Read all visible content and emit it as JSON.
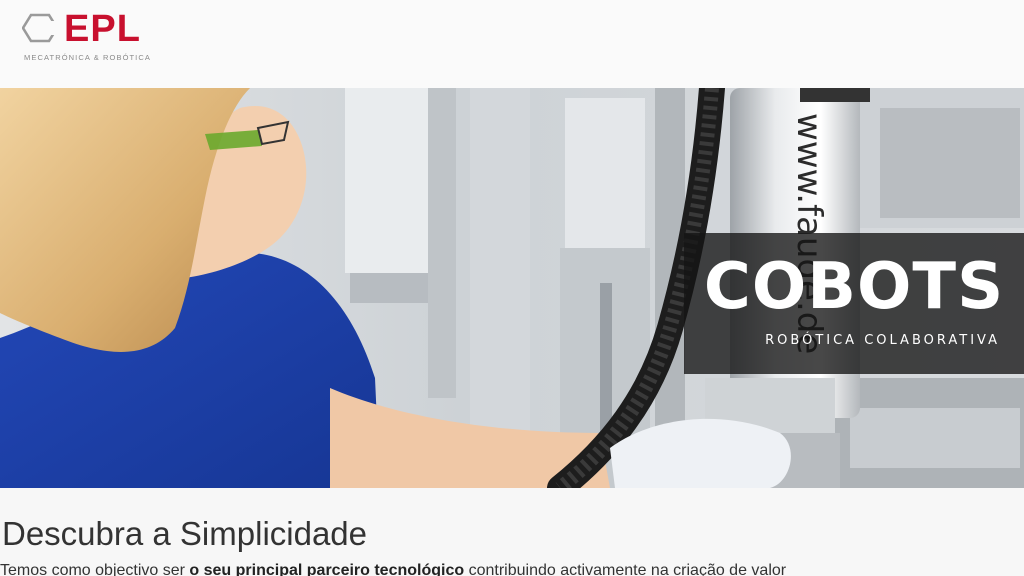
{
  "brand": {
    "name": "EPL",
    "tagline": "MECATRÓNICA & ROBÓTICA",
    "color": "#c8102e",
    "icon": "hexagon-logo-icon"
  },
  "hero": {
    "title": "COBOTS",
    "subtitle": "ROBÓTICA COLABORATIVA",
    "photo_text": "www.faude.de",
    "overlay_color": "#141414"
  },
  "content": {
    "heading": "Descubra a Simplicidade",
    "intro_before": "Temos como objectivo ser ",
    "intro_bold": "o seu principal parceiro tecnológico",
    "intro_after": " contribuindo activamente na criação de valor"
  }
}
